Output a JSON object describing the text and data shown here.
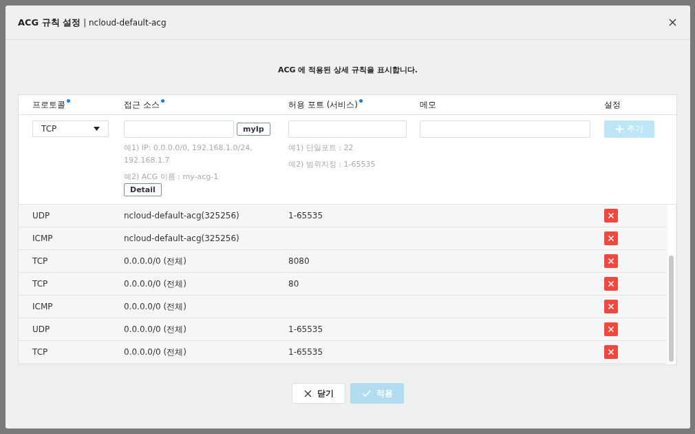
{
  "dialog": {
    "title": "ACG 규칙 설정",
    "subtitle": "| ncloud-default-acg",
    "description": "ACG 에 적용된 상세 규칙을 표시합니다."
  },
  "columns": [
    {
      "label": "프로토콜",
      "required": true
    },
    {
      "label": "접근 소스",
      "required": true
    },
    {
      "label": "허용 포트 (서비스)",
      "required": true
    },
    {
      "label": "메모",
      "required": false
    },
    {
      "label": "설정",
      "required": false
    }
  ],
  "form": {
    "protocol": "TCP",
    "myip_button": "myIp",
    "source_hints": [
      "예1) IP: 0.0.0.0/0, 192.168.1.0/24, 192.168.1.7",
      "예2) ACG 이름 : my-acg-1"
    ],
    "detail_button": "Detail",
    "port_hints": [
      "예1) 단일포트 : 22",
      "예2) 범위지정 : 1-65535"
    ],
    "add_button": {
      "label": "추가",
      "disabled": true
    }
  },
  "rules": [
    {
      "protocol": "UDP",
      "source": "ncloud-default-acg(325256)",
      "port": "1-65535"
    },
    {
      "protocol": "ICMP",
      "source": "ncloud-default-acg(325256)"
    },
    {
      "protocol": "TCP",
      "source": "0.0.0.0/0 (전체)",
      "port": "8080"
    },
    {
      "protocol": "TCP",
      "source": "0.0.0.0/0 (전체)",
      "port": "80"
    },
    {
      "protocol": "ICMP",
      "source": "0.0.0.0/0 (전체)"
    },
    {
      "protocol": "UDP",
      "source": "0.0.0.0/0 (전체)",
      "port": "1-65535"
    },
    {
      "protocol": "TCP",
      "source": "0.0.0.0/0 (전체)",
      "port": "1-65535"
    }
  ],
  "buttons": [
    {
      "label": "닫기",
      "kind": "close",
      "disabled": false
    },
    {
      "label": "적용",
      "kind": "apply",
      "disabled": true
    }
  ]
}
